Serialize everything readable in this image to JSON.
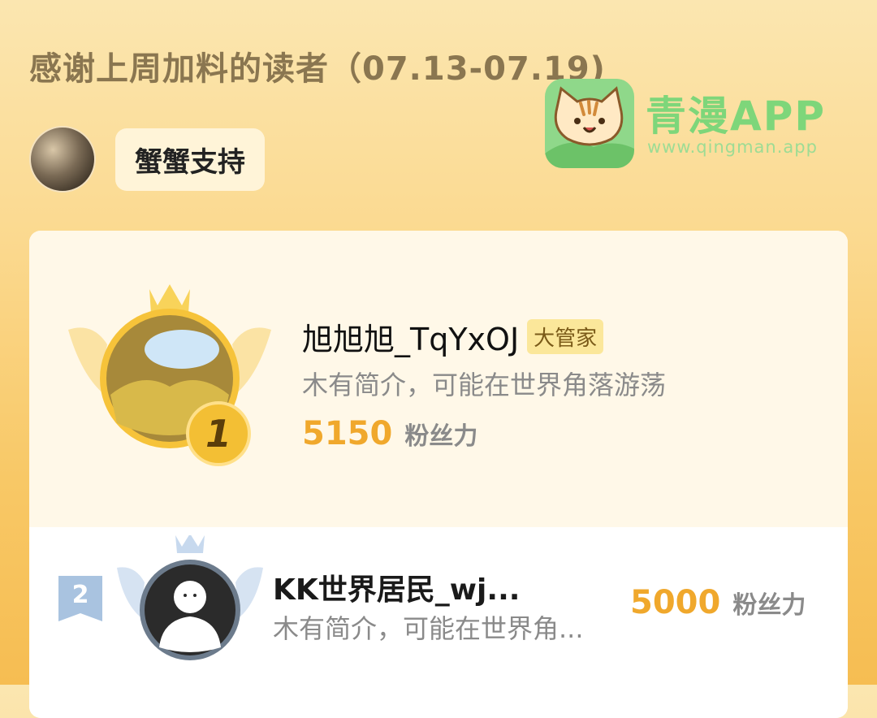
{
  "header": {
    "title": "感谢上周加料的读者（07.13-07.19)"
  },
  "supporter": {
    "label": "蟹蟹支持"
  },
  "watermark": {
    "title": "青漫APP",
    "url": "www.qingman.app"
  },
  "leaderboard": [
    {
      "rank": "1",
      "name": "旭旭旭_TqYxOJ",
      "badge": "大管家",
      "bio": "木有简介，可能在世界角落游荡",
      "score": "5150",
      "unit": "粉丝力"
    },
    {
      "rank": "2",
      "name": "KK世界居民_wj...",
      "bio": "木有简介，可能在世界角...",
      "score": "5000",
      "unit": "粉丝力"
    }
  ],
  "colors": {
    "accent": "#f0a82c",
    "badge_bg": "#fbe79a",
    "watermark_green": "#7ed67a"
  }
}
